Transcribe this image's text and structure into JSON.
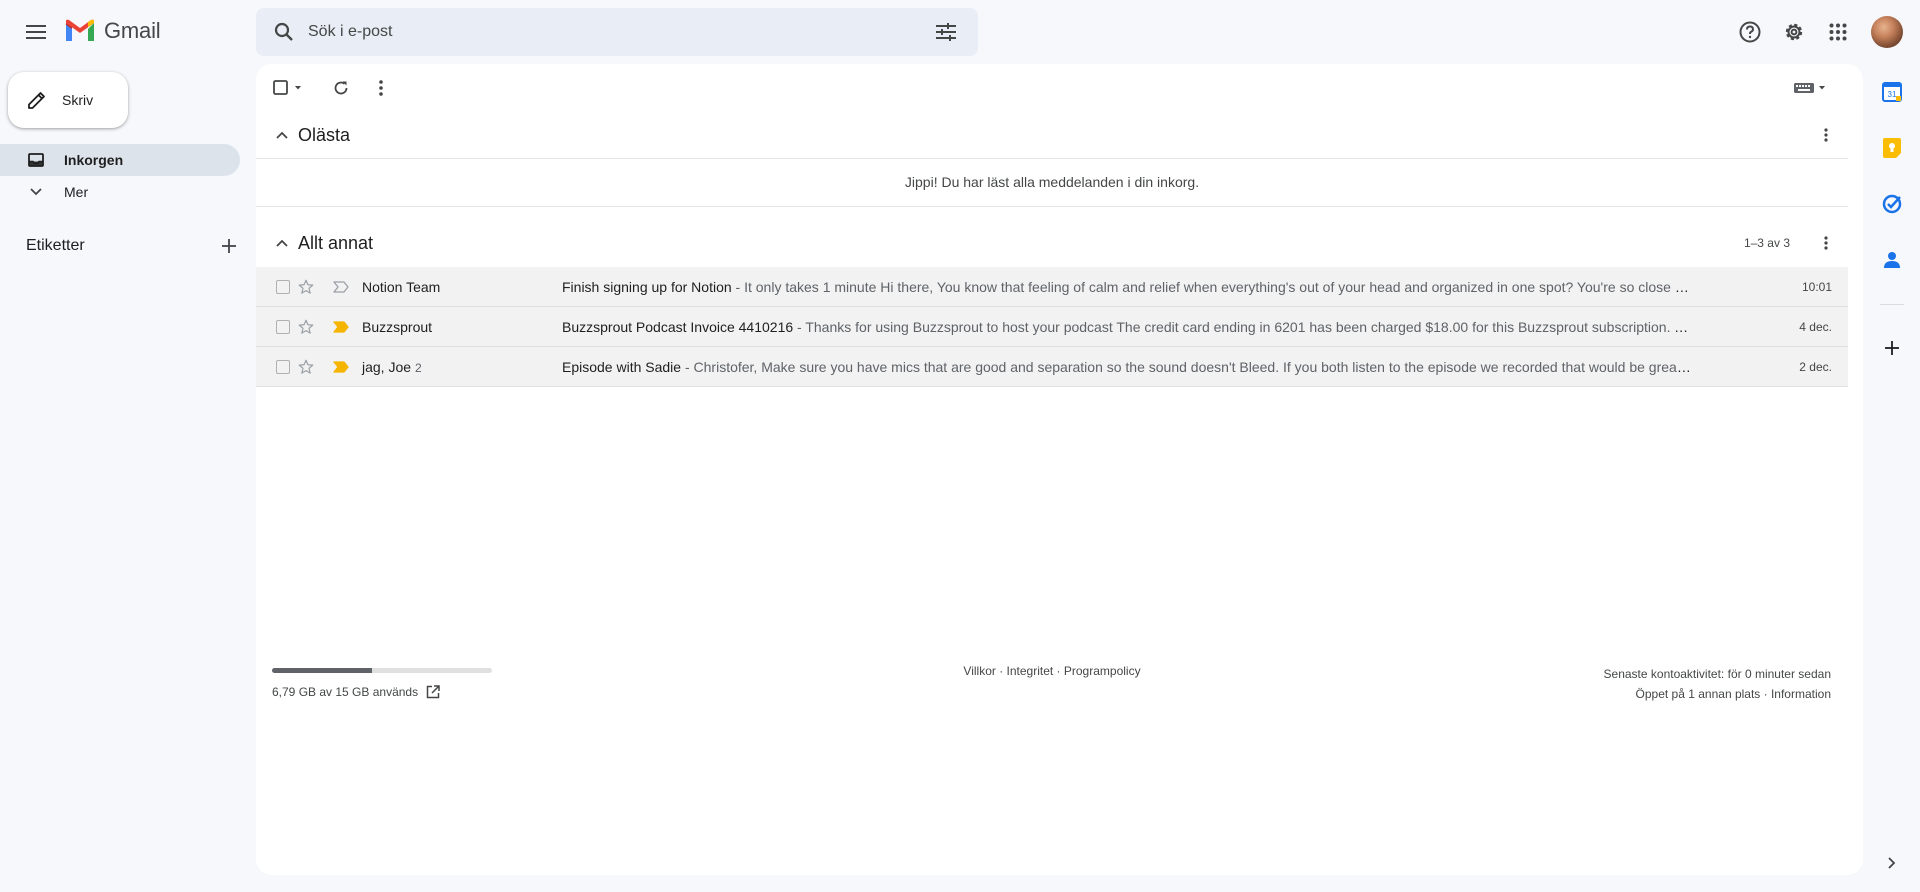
{
  "app": {
    "name": "Gmail"
  },
  "search": {
    "placeholder": "Sök i e-post"
  },
  "nav": {
    "compose_label": "Skriv",
    "items": [
      {
        "label": "Inkorgen",
        "icon": "inbox-icon",
        "active": true
      },
      {
        "label": "Mer",
        "icon": "chevron-down-icon",
        "active": false
      }
    ],
    "labels_title": "Etiketter"
  },
  "sections": {
    "unread": {
      "title": "Olästa",
      "empty_message": "Jippi! Du har läst alla meddelanden i din inkorg."
    },
    "other": {
      "title": "Allt annat",
      "count": "1–3 av 3"
    }
  },
  "emails": [
    {
      "sender": "Notion Team",
      "count": "",
      "subject": "Finish signing up for Notion",
      "snippet": " - It only takes 1 minute    Hi there, You know that feeling of calm and relief when everything's out of your head and organized in one spot? You're so close to ...",
      "date": "10:01",
      "important": false
    },
    {
      "sender": "Buzzsprout",
      "count": "",
      "subject": "Buzzsprout Podcast Invoice 4410216",
      "snippet": " - Thanks for using Buzzsprout to host your podcast The credit card ending in 6201 has been charged $18.00 for this Buzzsprout subscription. This ...",
      "date": "4 dec.",
      "important": true
    },
    {
      "sender": "jag, Joe",
      "count": "2",
      "subject": "Episode with Sadie",
      "snippet": " - Christofer, Make sure you have mics that are good and separation so the sound doesn't Bleed. If you both listen to the episode we recorded that would be great. T...",
      "date": "2 dec.",
      "important": true
    }
  ],
  "footer": {
    "storage_text": "6,79 GB av 15 GB används",
    "storage_fraction": 0.453,
    "links": "Villkor · Integritet · Programpolicy",
    "activity": "Senaste kontoaktivitet: för 0 minuter sedan",
    "sessions": "Öppet på 1 annan plats · Information"
  },
  "colors": {
    "background": "#f6f8fc",
    "search_bg": "#e9eef6",
    "important": "#f4b400",
    "row_bg": "#f2f2f2"
  }
}
